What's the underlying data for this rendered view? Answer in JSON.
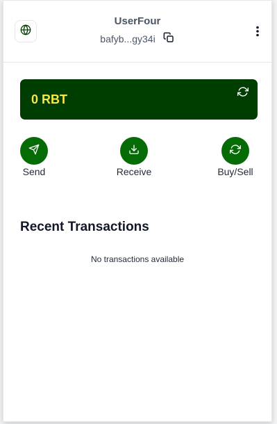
{
  "header": {
    "account_name": "UserFour",
    "address": "bafyb...gy34i"
  },
  "balance": {
    "amount": "0 RBT"
  },
  "actions": [
    {
      "label": "Send",
      "icon": "send-icon"
    },
    {
      "label": "Receive",
      "icon": "download-icon"
    },
    {
      "label": "Buy/Sell",
      "icon": "swap-icon"
    }
  ],
  "transactions": {
    "title": "Recent Transactions",
    "empty_message": "No transactions available"
  },
  "colors": {
    "accent": "#056b05",
    "card_bg": "#003d00",
    "balance_text": "#f5e94a"
  }
}
